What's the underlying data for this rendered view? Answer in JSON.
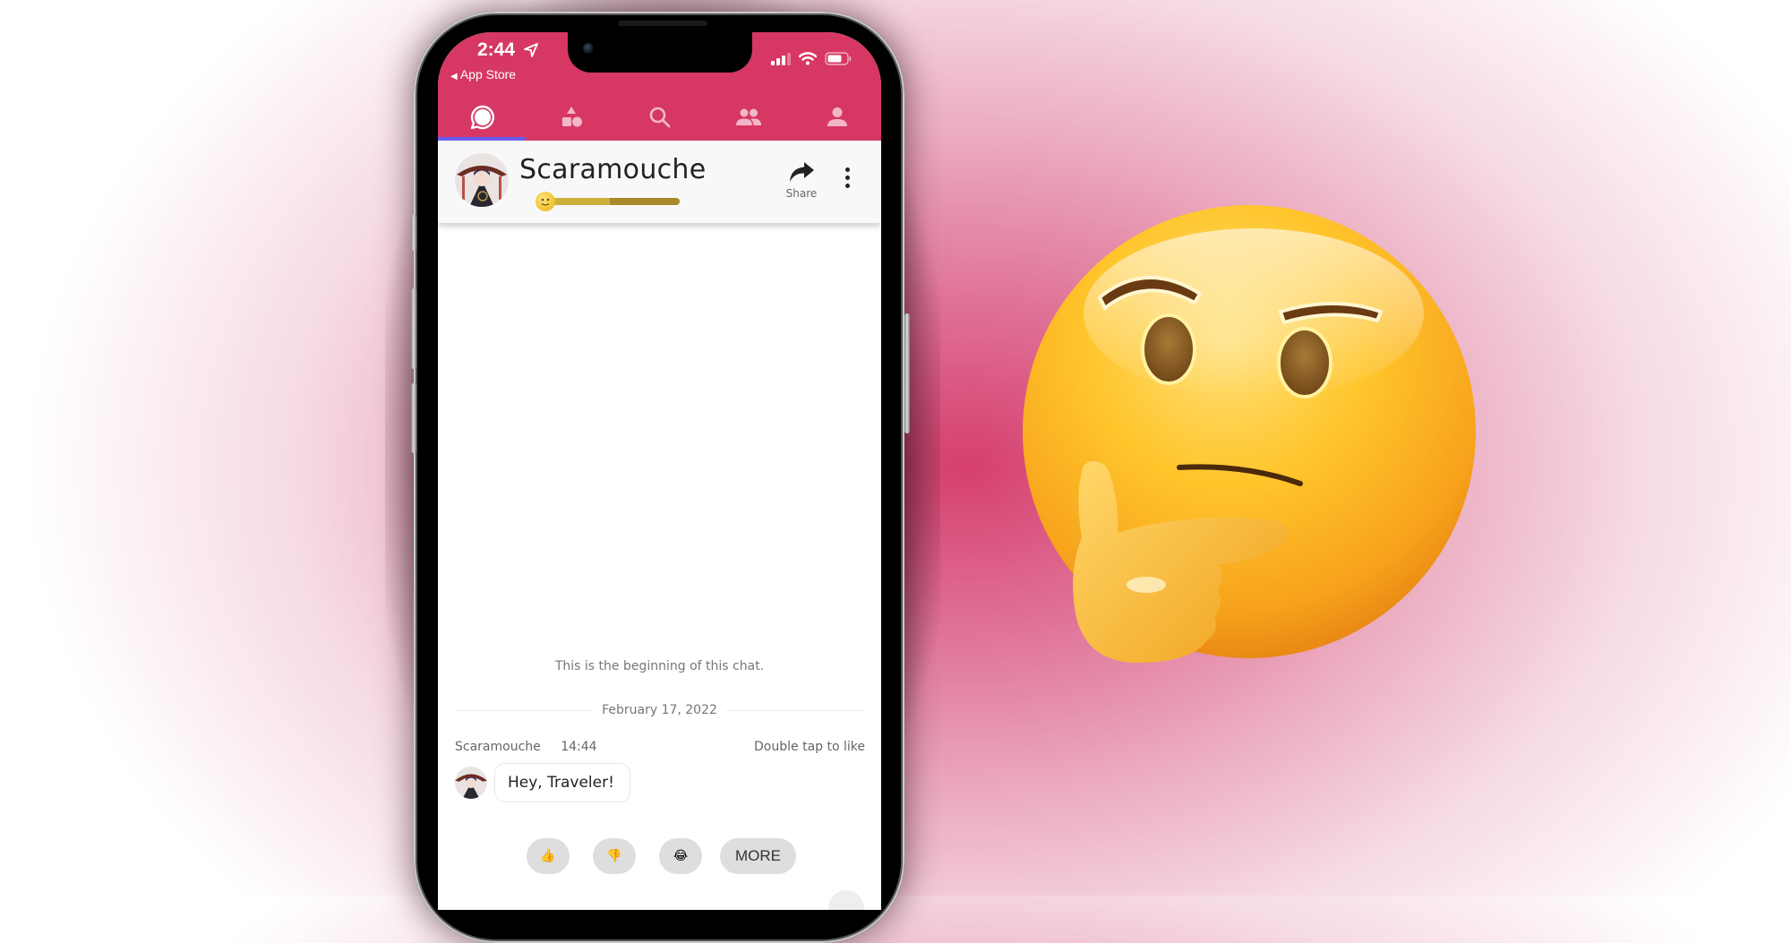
{
  "status_bar": {
    "time": "2:44",
    "back_label": "App Store",
    "icons": [
      "location-arrow-icon",
      "signal-icon",
      "wifi-icon",
      "battery-icon"
    ]
  },
  "nav_tabs": [
    {
      "name": "chats",
      "icon": "chat-bubble-icon",
      "active": true
    },
    {
      "name": "categories",
      "icon": "shapes-icon",
      "active": false
    },
    {
      "name": "search",
      "icon": "search-icon",
      "active": false
    },
    {
      "name": "community",
      "icon": "group-icon",
      "active": false
    },
    {
      "name": "profile",
      "icon": "person-icon",
      "active": false
    }
  ],
  "chat_header": {
    "character_name": "Scaramouche",
    "relationship_progress": 0.49,
    "share_label": "Share"
  },
  "chat": {
    "beginning_text": "This is the beginning of this chat.",
    "date_divider": "February 17, 2022",
    "messages": [
      {
        "sender": "Scaramouche",
        "time": "14:44",
        "hint": "Double tap to like",
        "text": "Hey, Traveler!"
      }
    ],
    "reactions": [
      {
        "name": "thumbs-up",
        "glyph": "👍"
      },
      {
        "name": "thumbs-down",
        "glyph": "👎"
      },
      {
        "name": "tears-of-joy",
        "glyph": "😂"
      },
      {
        "name": "more",
        "glyph": "MORE"
      }
    ]
  },
  "colors": {
    "brand": "#d63863",
    "active_tab_underline": "#6b5cf0",
    "progress_fill": "#cdb03c",
    "progress_track": "#a88a2a"
  },
  "decoration": {
    "emoji": "thinking-face"
  }
}
